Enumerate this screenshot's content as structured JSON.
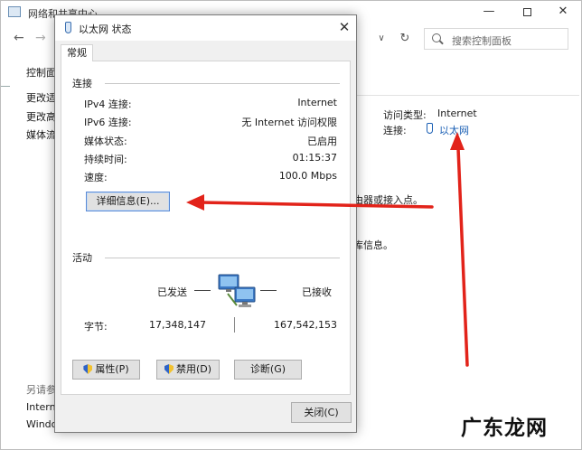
{
  "background_window": {
    "title": "网络和共享中心",
    "search_placeholder": "搜索控制面板",
    "sidebar": {
      "item1": "控制面",
      "item2": "更改适",
      "item3": "更改高",
      "item4": "媒体流",
      "see_also": "另请参",
      "item5": "Interne",
      "item6": "Windo"
    },
    "access_type_label": "访问类型:",
    "access_type_value": "Internet",
    "connections_label": "连接:",
    "connection_link": "以太网",
    "fragment1": "由器或接入点。",
    "fragment2": "库信息。"
  },
  "dialog": {
    "title": "以太网 状态",
    "tab": "常规",
    "connection_group": "连接",
    "rows": [
      {
        "label": "IPv4 连接:",
        "value": "Internet"
      },
      {
        "label": "IPv6 连接:",
        "value": "无 Internet 访问权限"
      },
      {
        "label": "媒体状态:",
        "value": "已启用"
      },
      {
        "label": "持续时间:",
        "value": "01:15:37"
      },
      {
        "label": "速度:",
        "value": "100.0 Mbps"
      }
    ],
    "details_button": "详细信息(E)...",
    "activity_group": "活动",
    "sent_label": "已发送",
    "received_label": "已接收",
    "bytes_label": "字节:",
    "bytes_sent": "17,348,147",
    "bytes_received": "167,542,153",
    "properties_button": "属性(P)",
    "disable_button": "禁用(D)",
    "diagnose_button": "诊断(G)",
    "close_button": "关闭(C)"
  },
  "watermark": "广东龙网",
  "colors": {
    "arrow": "#e2231a",
    "link": "#1a5fb4",
    "dialog_bg": "#f0f0f0",
    "focus_border": "#5a8ad6"
  }
}
